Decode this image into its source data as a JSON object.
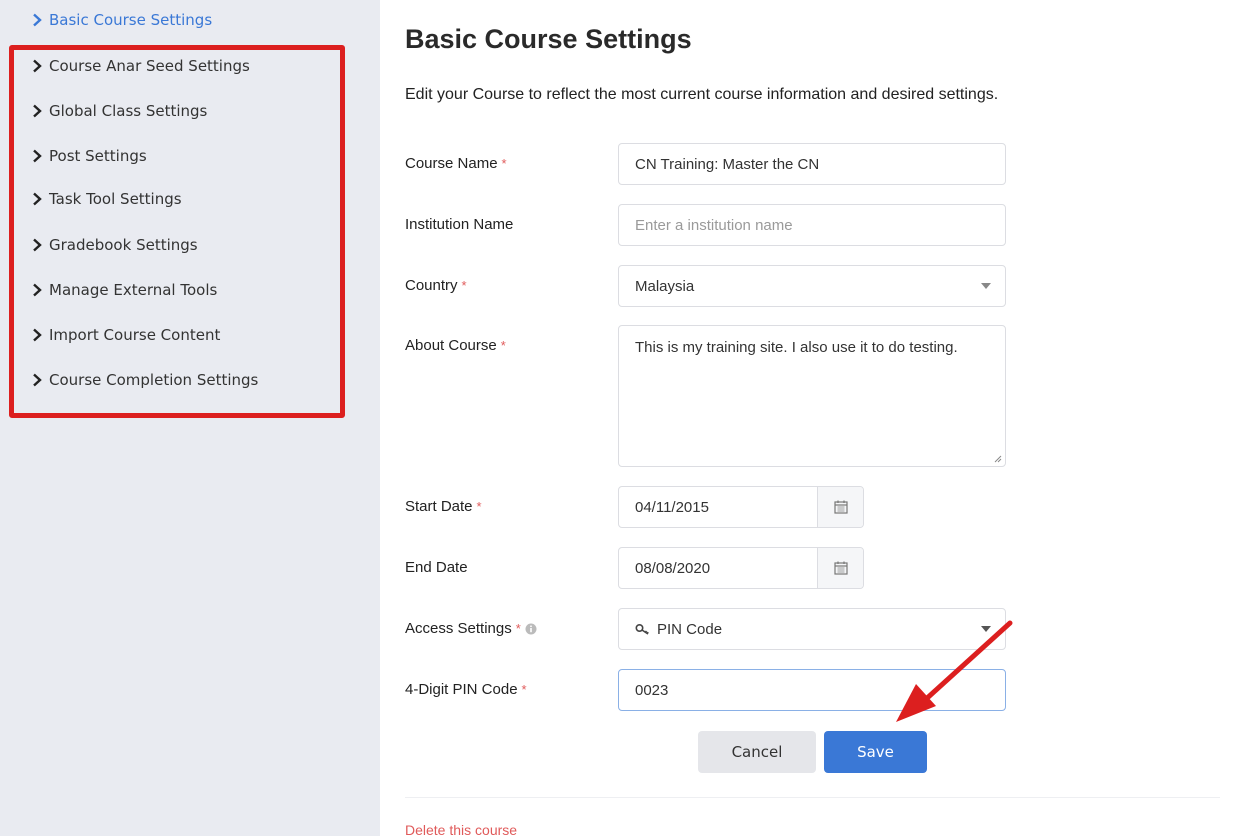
{
  "sidebar": {
    "items": [
      {
        "label": "Basic Course Settings",
        "active": true
      },
      {
        "label": "Course Anar Seed Settings"
      },
      {
        "label": "Global Class Settings"
      },
      {
        "label": "Post Settings"
      },
      {
        "label": "Task Tool Settings"
      },
      {
        "label": "Gradebook Settings"
      },
      {
        "label": "Manage External Tools"
      },
      {
        "label": "Import Course Content"
      },
      {
        "label": "Course Completion Settings"
      }
    ]
  },
  "main": {
    "title": "Basic Course Settings",
    "description": "Edit your Course to reflect the most current course information and desired settings.",
    "fields": {
      "course_name": {
        "label": "Course Name",
        "required": "*",
        "value": "CN Training: Master the CN"
      },
      "institution_name": {
        "label": "Institution Name",
        "placeholder": "Enter a institution name"
      },
      "country": {
        "label": "Country",
        "required": "*",
        "value": "Malaysia"
      },
      "about_course": {
        "label": "About Course",
        "required": "*",
        "value": "This is my training site. I also use it to do testing."
      },
      "start_date": {
        "label": "Start Date",
        "required": "*",
        "value": "04/11/2015"
      },
      "end_date": {
        "label": "End Date",
        "value": "08/08/2020"
      },
      "access_settings": {
        "label": "Access Settings",
        "required": "*",
        "value": "PIN Code"
      },
      "pin_code": {
        "label": "4-Digit PIN Code",
        "required": "*",
        "value": "0023"
      }
    },
    "buttons": {
      "cancel": "Cancel",
      "save": "Save"
    },
    "delete_link": "Delete this course"
  },
  "colors": {
    "accent": "#3a78d6",
    "highlight": "#dc1f1f",
    "required": "#e05a5a",
    "sidebar_bg": "#e9ebf1"
  },
  "icons": [
    "chevron-right-icon",
    "calendar-icon",
    "key-icon",
    "info-icon",
    "caret-down-icon",
    "arrow-annotation"
  ]
}
